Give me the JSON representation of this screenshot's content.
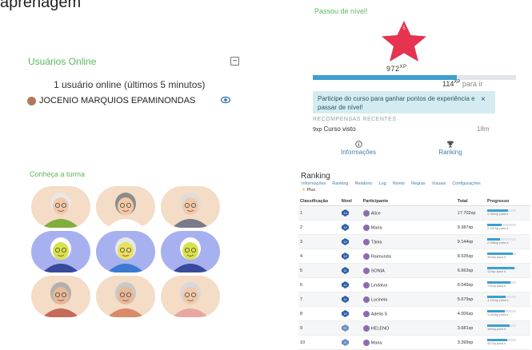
{
  "top_cut_text": "aprenagem",
  "online": {
    "title": "Usuários Online",
    "count_text": "1 usuário online (últimos 5 minutos)",
    "user_name": "JOCENIO MARQUIOS EPAMINONDAS"
  },
  "level": {
    "title": "Passou de nível!",
    "level_number": "5",
    "xp": "972",
    "xp_unit": "XP",
    "progress_fraction": 0.71,
    "next_value": "114",
    "next_unit": "XP",
    "next_suffix": "para ir",
    "info_text": "Participe do curso para ganhar pontos de experiência e passar de nível!",
    "close_glyph": "×",
    "recent_title": "RECOMPENSAS RECENTES",
    "recent_item_xp": "9xp",
    "recent_item_label": "Curso visto",
    "recent_item_time": "18m",
    "btn_info": "Informações",
    "btn_ranking": "Ranking"
  },
  "class": {
    "title": "Conheça a turma",
    "avatars": [
      {
        "bg": "#f4dcc6",
        "skin": "#f2c9a8",
        "hair": "#e8e8e8",
        "shirt": "#7fae3b"
      },
      {
        "bg": "#f4dcc6",
        "skin": "#f2c9a8",
        "hair": "#8c8c8c",
        "shirt": "#ffffff"
      },
      {
        "bg": "#f4dcc6",
        "skin": "#f2c9a8",
        "hair": "#dddddd",
        "shirt": "#7a7a8a"
      },
      {
        "bg": "#a8b1f0",
        "skin": "#d8e24a",
        "hair": "#ffffff",
        "shirt": "#3a4a9a"
      },
      {
        "bg": "#a8b1f0",
        "skin": "#e8e060",
        "hair": "#e8e8e8",
        "shirt": "#3a7ad0"
      },
      {
        "bg": "#a8b1f0",
        "skin": "#d8e24a",
        "hair": "#ffffff",
        "shirt": "#3a4a9a"
      },
      {
        "bg": "#f4dcc6",
        "skin": "#e8b898",
        "hair": "#b0b0b0",
        "shirt": "#c46a5a"
      },
      {
        "bg": "#f4dcc6",
        "skin": "#e8b898",
        "hair": "#c8c8c8",
        "shirt": "#d88a6a"
      },
      {
        "bg": "#f4dcc6",
        "skin": "#f2c9a8",
        "hair": "#d8d8d8",
        "shirt": "#e8a8a0"
      }
    ]
  },
  "ranking": {
    "title": "Ranking",
    "tabs": [
      "Informações",
      "Ranking",
      "Relatório",
      "Log",
      "Níveis",
      "Regras",
      "Visuais",
      "Configurações"
    ],
    "plus_label": "Plus",
    "headers": [
      "Classificação",
      "Nível",
      "Participante",
      "Total",
      "Progresso"
    ],
    "rows": [
      {
        "pos": "1",
        "level": "14",
        "name": "Alice",
        "total": "17.702xp",
        "progress": 0.72,
        "ptext": "2.302xp para ir"
      },
      {
        "pos": "2",
        "level": "12",
        "name": "Maria",
        "total": "9.387xp",
        "progress": 0.5,
        "ptext": "2.347xp para ir"
      },
      {
        "pos": "3",
        "level": "12",
        "name": "Tânia",
        "total": "9.144xp",
        "progress": 0.45,
        "ptext": "2.556xp para ir"
      },
      {
        "pos": "4",
        "level": "12",
        "name": "Raimunda",
        "total": "8.535xp",
        "progress": 0.88,
        "ptext": "344xp para ir"
      },
      {
        "pos": "5",
        "level": "11",
        "name": "SONIA",
        "total": "6.663xp",
        "progress": 0.95,
        "ptext": "113xp para ir"
      },
      {
        "pos": "6",
        "level": "11",
        "name": "Lindalva",
        "total": "6.049xp",
        "progress": 0.8,
        "ptext": "731xp para ir"
      },
      {
        "pos": "7",
        "level": "11",
        "name": "Lucineia",
        "total": "5.679xp",
        "progress": 0.65,
        "ptext": "1.101xp para ir"
      },
      {
        "pos": "8",
        "level": "10",
        "name": "Adelia S",
        "total": "4.006xp",
        "progress": 0.6,
        "ptext": "1.004xp para ir"
      },
      {
        "pos": "9",
        "level": "9",
        "name": "HELENO",
        "total": "3.681xp",
        "progress": 0.78,
        "ptext": "169xp para ir"
      },
      {
        "pos": "10",
        "level": "9",
        "name": "Maria",
        "total": "3.399xp",
        "progress": 0.7,
        "ptext": "447xp para ir"
      }
    ]
  }
}
